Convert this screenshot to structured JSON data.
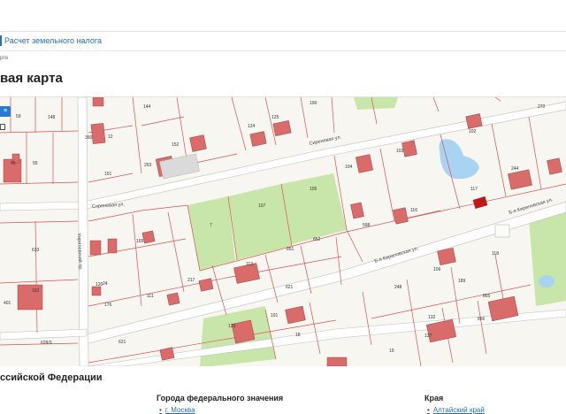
{
  "header": {
    "nav_link": "Расчет земельного налога",
    "breadcrumb": "рте",
    "title": "вая карта"
  },
  "map": {
    "layer_button": "≡",
    "streets": [
      {
        "id": "sirenevaya-1",
        "label": "Сиреневая ул."
      },
      {
        "id": "sirenevaya-2",
        "label": "Сиреневая ул."
      },
      {
        "id": "kirilovskaya-1",
        "label": "Б-я Кириловская ул."
      },
      {
        "id": "kirilovskaya-2",
        "label": "Б-я Кириловская ул."
      },
      {
        "id": "kirilovskiy",
        "label": "Кириловский пр."
      }
    ],
    "parcel_labels": [
      "59",
      "148",
      "144",
      "196",
      "270",
      "360",
      "12",
      "152",
      "124",
      "125",
      "102",
      "103",
      "104",
      "45",
      "55",
      "151",
      "263",
      "244",
      "107",
      "105",
      "7",
      "116",
      "117",
      "598",
      "852",
      "851",
      "633",
      "165",
      "113",
      "621",
      "217",
      "248",
      "109",
      "189",
      "111",
      "24",
      "176",
      "162",
      "865",
      "866",
      "132",
      "191",
      "123",
      "401",
      "628/3",
      "118",
      "18",
      "137",
      "120",
      "19",
      "621"
    ],
    "colors": {
      "parcel_fill": "#fbfbf8",
      "boundary": "#d9534f",
      "building": "#d96b6b",
      "green": "#c8e6a9",
      "water": "#a9d3f2",
      "road": "#ffffff"
    }
  },
  "regions": {
    "section_title": "ссийской Федерации",
    "federal_title": "Города федерального значения",
    "federal_items": [
      "г. Москва"
    ],
    "krai_title": "Края",
    "krai_items": [
      "Алтайский край"
    ]
  }
}
